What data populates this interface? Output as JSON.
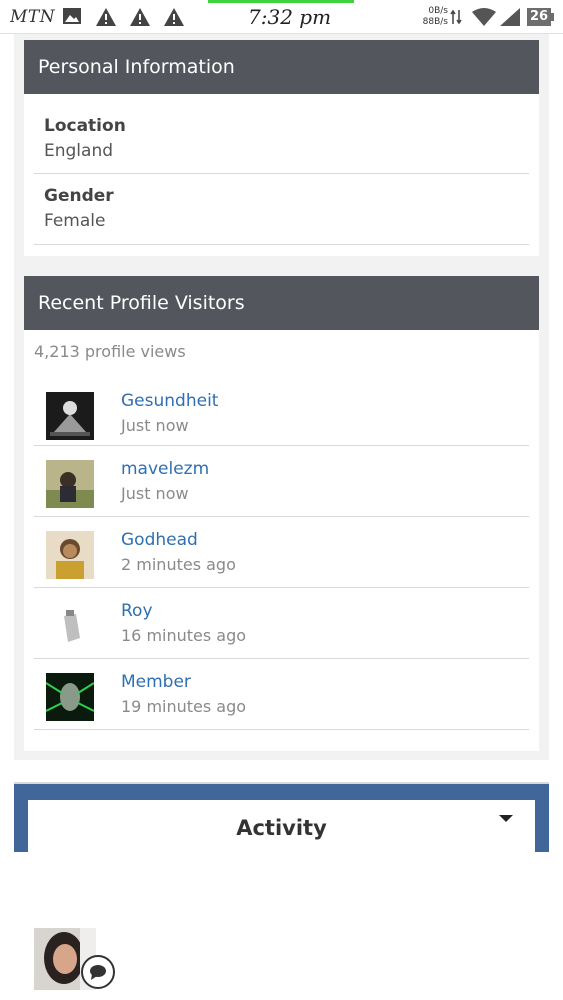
{
  "status_bar": {
    "carrier": "MTN",
    "time": "7:32 pm",
    "net_up": "0B/s",
    "net_down": "88B/s",
    "battery": "26",
    "icons": [
      "image-icon",
      "warning-icon",
      "warning-icon",
      "warning-icon",
      "data-arrows-icon",
      "wifi-icon",
      "signal-icon",
      "battery-icon"
    ]
  },
  "personal_info": {
    "title": "Personal Information",
    "fields": [
      {
        "label": "Location",
        "value": "England"
      },
      {
        "label": "Gender",
        "value": "Female"
      }
    ]
  },
  "visitors": {
    "title": "Recent Profile Visitors",
    "views": "4,213 profile views",
    "items": [
      {
        "name": "Gesundheit",
        "time": "Just now"
      },
      {
        "name": "mavelezm",
        "time": "Just now"
      },
      {
        "name": "Godhead",
        "time": "2 minutes ago"
      },
      {
        "name": "Roy",
        "time": "16 minutes ago"
      },
      {
        "name": "Member",
        "time": "19 minutes ago"
      }
    ]
  },
  "activity": {
    "title": "Activity"
  },
  "colors": {
    "header_bg": "#53565d",
    "link": "#2f6fb2",
    "activity_bar": "#41679a"
  }
}
